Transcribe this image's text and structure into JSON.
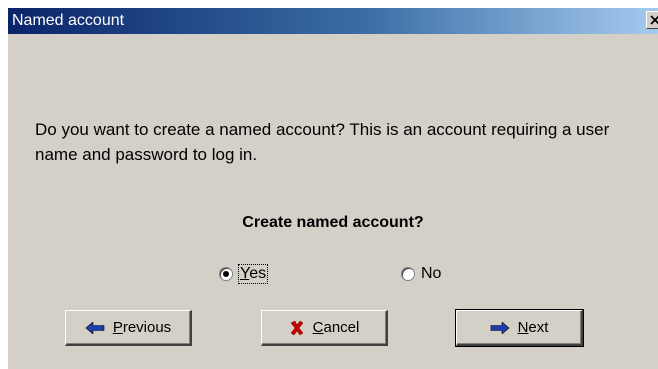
{
  "window": {
    "title": "Named account"
  },
  "body": {
    "description": "Do you want to create a named account? This is an account requiring a user name and password to log in.",
    "question": "Create named account?"
  },
  "options": [
    {
      "label_access": "Y",
      "label_rest": "es",
      "selected": true
    },
    {
      "label": "No",
      "selected": false
    }
  ],
  "buttons": {
    "previous": {
      "access": "P",
      "rest": "revious",
      "icon": "arrow-left-icon"
    },
    "cancel": {
      "access": "C",
      "rest": "ancel",
      "icon": "red-x-icon"
    },
    "next": {
      "access": "N",
      "rest": "ext",
      "icon": "arrow-right-icon"
    }
  },
  "colors": {
    "titlebar_start": "#0a246a",
    "titlebar_end": "#a6caf0",
    "dialog_bg": "#d4d0c8",
    "arrow_blue": "#1f3fae",
    "cancel_red": "#cc0000"
  }
}
